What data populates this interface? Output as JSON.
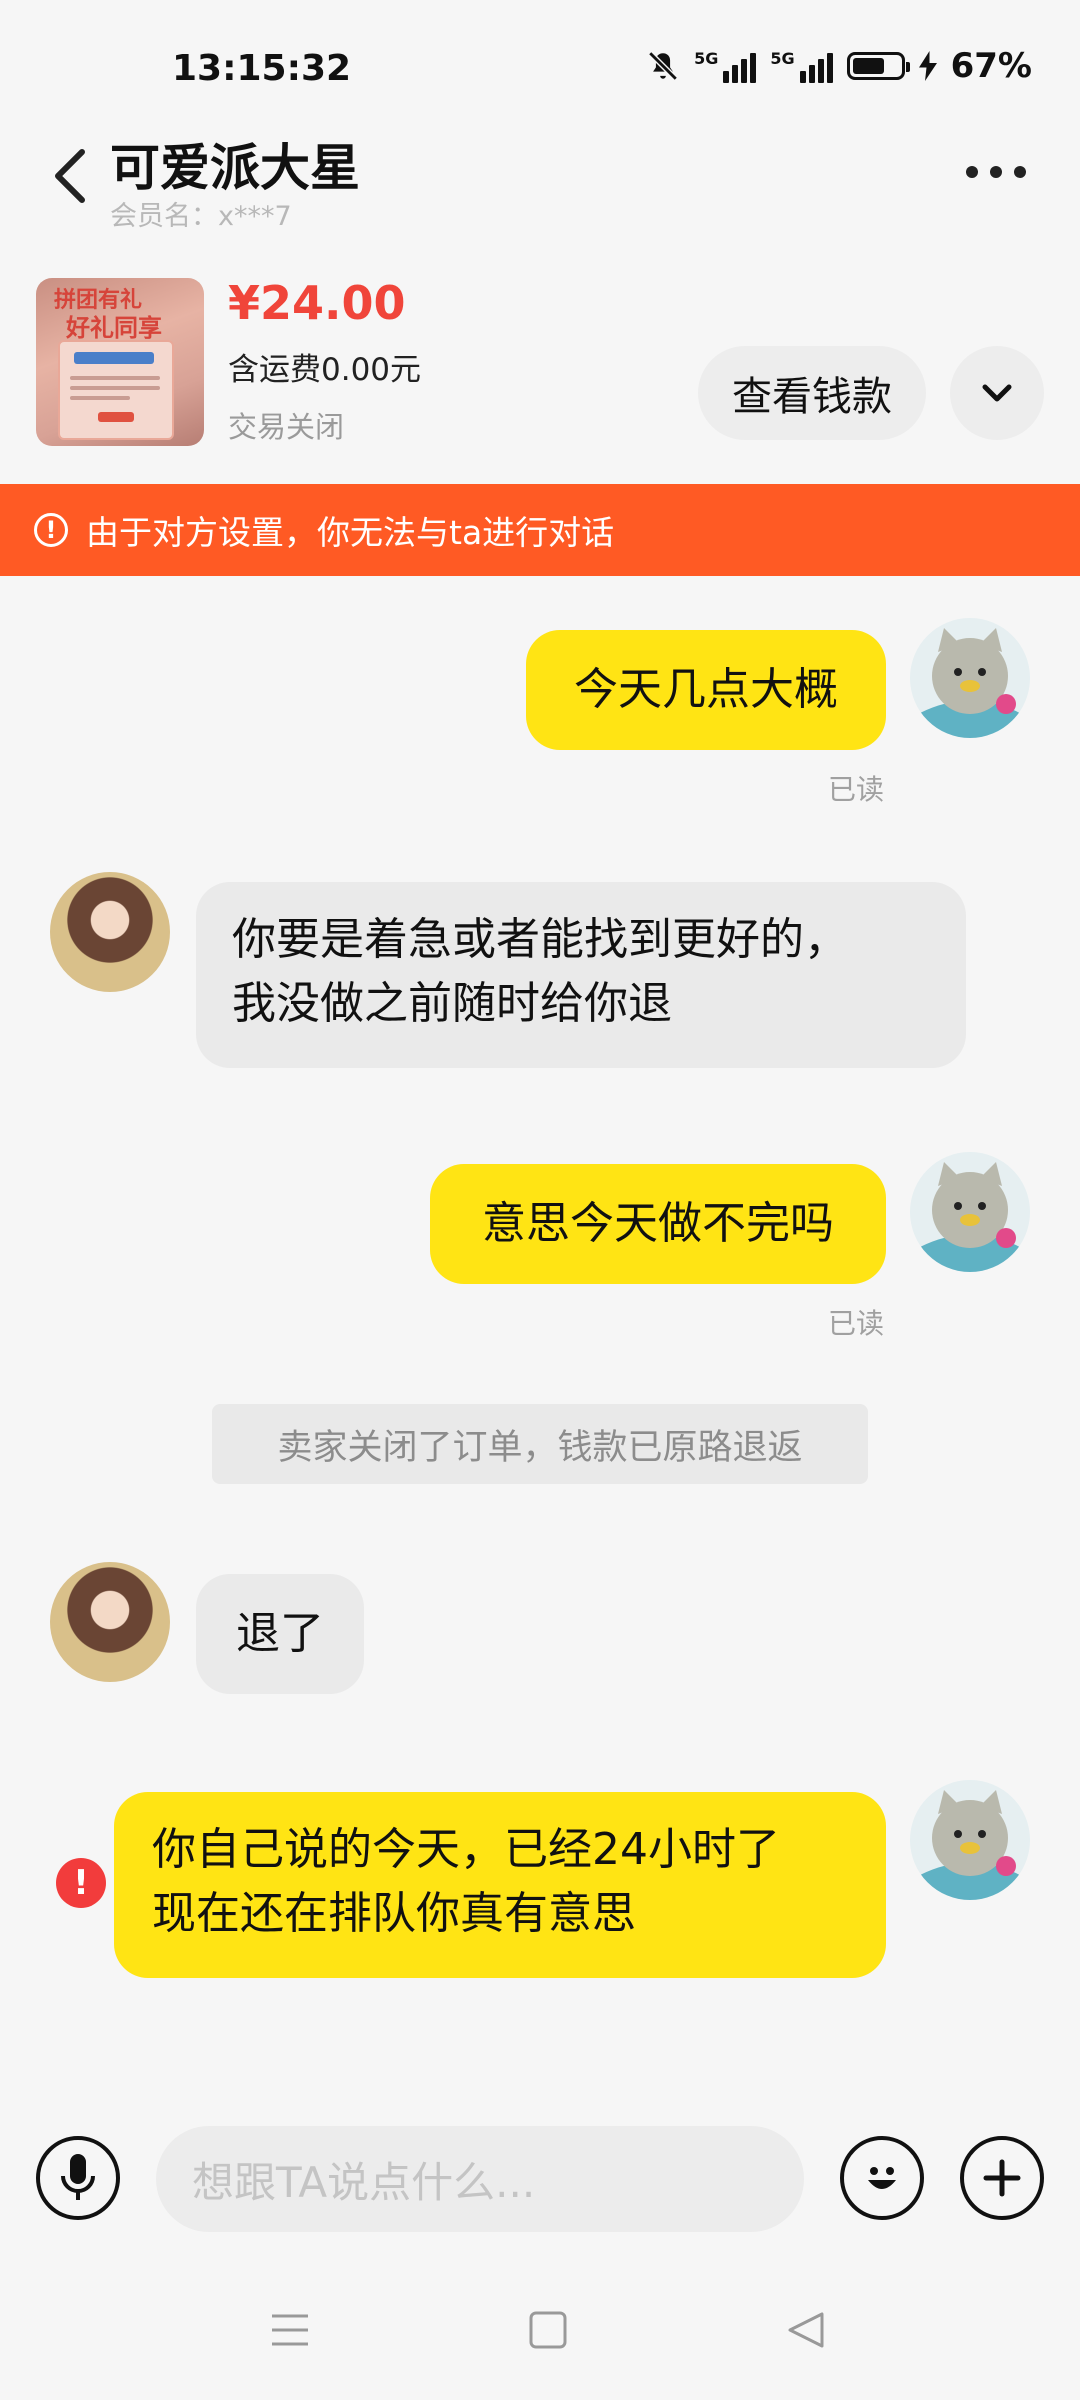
{
  "status_bar": {
    "time": "13:15:32",
    "network1": "5G",
    "network2": "5G",
    "battery": "67%",
    "battery_level": 0.67,
    "icons": [
      "mute-bell-icon",
      "signal-icon",
      "battery-icon",
      "charging-bolt-icon"
    ]
  },
  "header": {
    "title": "可爱派大星",
    "member": "会员名：x***7"
  },
  "product": {
    "price": "¥24.00",
    "shipping": "含运费0.00元",
    "status": "交易关闭",
    "thumb_line1": "拼团有礼",
    "thumb_line2": "好礼同享",
    "view_button": "查看钱款"
  },
  "warning": {
    "text": "由于对方设置，你无法与ta进行对话"
  },
  "messages": [
    {
      "from": "me",
      "text": "今天几点大概",
      "read": "已读"
    },
    {
      "from": "them",
      "lines": [
        "你要是着急或者能找到更好的，",
        "我没做之前随时给你退"
      ]
    },
    {
      "from": "me",
      "text": "意思今天做不完吗",
      "read": "已读"
    },
    {
      "from": "system",
      "text": "卖家关闭了订单，钱款已原路退返"
    },
    {
      "from": "them",
      "text": "退了"
    },
    {
      "from": "me",
      "lines": [
        "你自己说的今天，已经24小时了",
        "现在还在排队你真有意思"
      ],
      "failed": true
    }
  ],
  "input_bar": {
    "placeholder": "想跟TA说点什么..."
  },
  "colors": {
    "my_bubble": "#ffe414",
    "their_bubble": "#eaeaea",
    "warning": "#ff5a24",
    "price": "#f0453a",
    "error": "#f23c3c"
  }
}
